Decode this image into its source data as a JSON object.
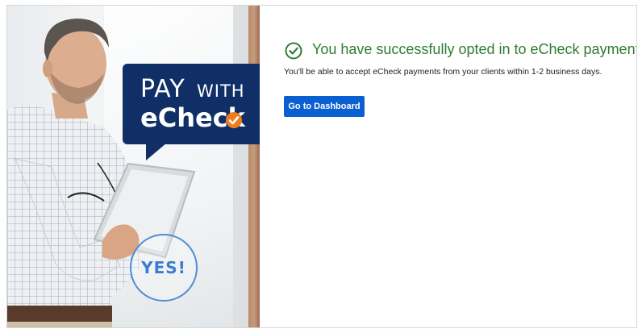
{
  "promo": {
    "headline_pay": "PAY",
    "headline_with": "WITH",
    "brand": "eCheck",
    "yes_label": "YES!",
    "colors": {
      "bubble": "#0f2f66",
      "badge": "#f07d1c",
      "yes": "#3c7cd0"
    }
  },
  "status": {
    "icon": "check-circle-icon",
    "title": "You have successfully opted in to eCheck payments!",
    "subtitle": "You'll be able to accept eCheck payments from your clients within 1-2 business days.",
    "color": "#2e7d32"
  },
  "actions": {
    "dashboard_label": "Go to Dashboard",
    "button_color": "#0a5fd1"
  }
}
